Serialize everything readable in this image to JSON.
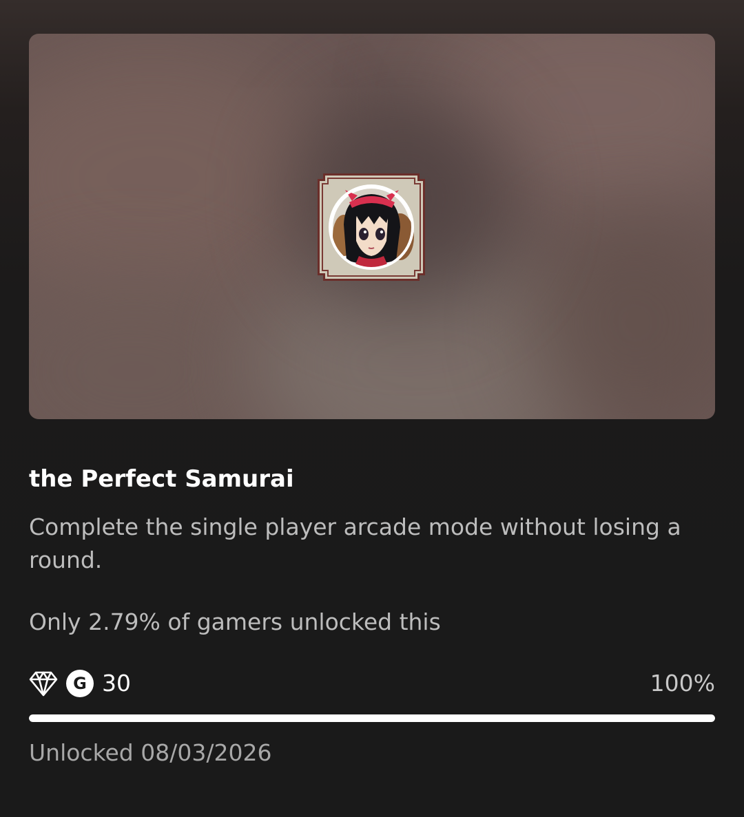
{
  "achievement": {
    "title": "the Perfect Samurai",
    "description": "Complete the single player arcade mode without losing a round.",
    "rarity_text": "Only 2.79% of gamers unlocked this",
    "gamerscore_icon_letter": "G",
    "gamerscore": "30",
    "rarity_icon": "diamond-icon",
    "progress_percent_label": "100%",
    "progress_fraction": 1.0,
    "unlocked_text": "Unlocked 08/03/2026"
  },
  "hero": {
    "badge_icon": "achievement-badge-portrait-icon"
  },
  "colors": {
    "background": "#1a1a1a",
    "title": "#ffffff",
    "secondary_text": "#bdbdbd",
    "progress_fill": "#ffffff",
    "hero_tint": "#6a5754"
  }
}
